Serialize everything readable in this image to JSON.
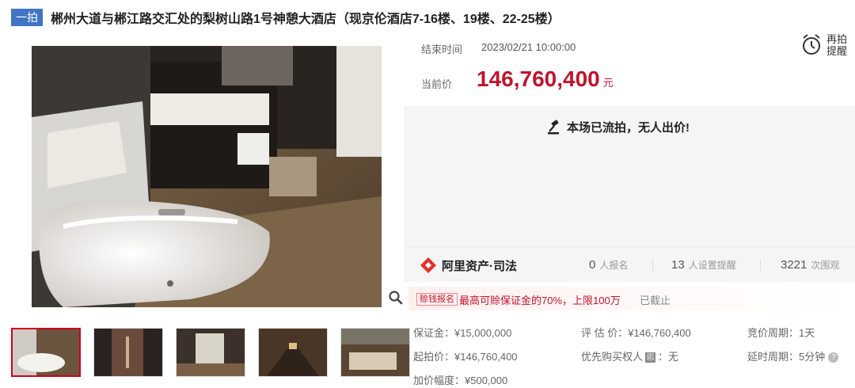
{
  "header": {
    "tag": "一拍",
    "title": "郴州大道与郴江路交汇处的梨树山路1号神憩大酒店（现京伦酒店7-16楼、19楼、22-25楼）"
  },
  "auction": {
    "end_label": "结束时间",
    "end_time": "2023/02/21 10:00:00",
    "price_label": "当前价",
    "price": "146,760,400",
    "price_unit": "元",
    "remind_label": "再拍提醒",
    "status": "本场已流拍，无人出价!"
  },
  "stats": {
    "brand": "阿里资产·司法",
    "signup_count": "0",
    "signup_label": "人报名",
    "remind_count": "13",
    "remind_label": "人设置提醒",
    "view_count": "3221",
    "view_label": "次围观"
  },
  "deposit": {
    "tag": "赊钱报名",
    "text": "最高可赊保证金的70%，上限100万",
    "status": "已截止"
  },
  "details": {
    "bond": "保证金：¥15,000,000",
    "start_price": "起拍价：¥146,760,400",
    "increment": "加价幅度：¥500,000",
    "appraisal": "评 估 价：¥146,760,400",
    "priority_label": "优先购买权人",
    "priority_badge": "囸",
    "priority_value": "：无",
    "bid_cycle": "竞价周期：1天",
    "delay_cycle": "延时周期：5分钟",
    "help_icon": "?"
  },
  "icons": {
    "zoom": "search-icon",
    "remind": "alarm-clock-icon",
    "status": "gavel-icon",
    "brand": "alibaba-logo-icon"
  },
  "colors": {
    "accent_red": "#c1142b",
    "tag_blue": "#3f75c4"
  }
}
